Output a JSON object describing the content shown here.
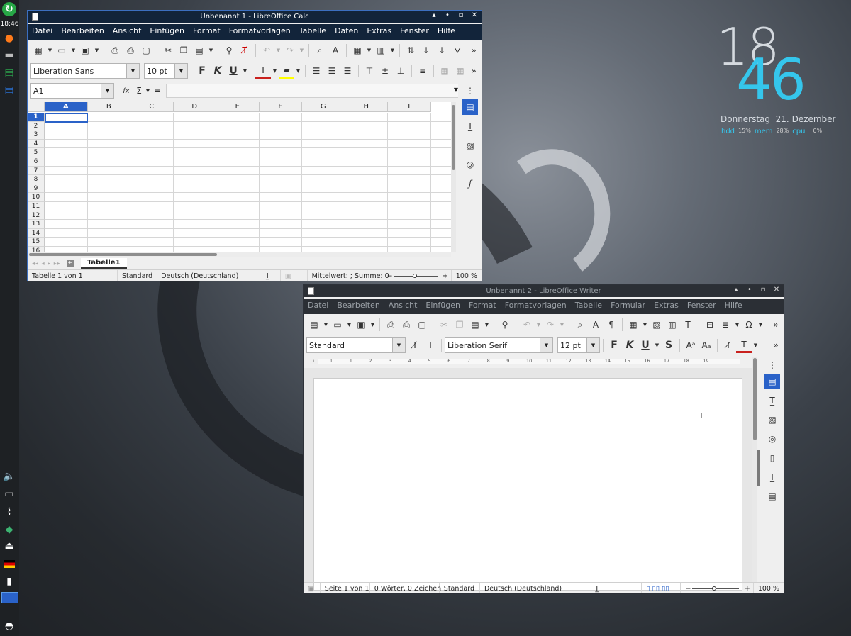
{
  "panel": {
    "time": "18:46"
  },
  "clock_widget": {
    "hour": "18",
    "minute": "46",
    "date": "Donnerstag  21. Dezember",
    "stats": [
      {
        "label": "hdd",
        "value": "15%"
      },
      {
        "label": "mem",
        "value": "28%"
      },
      {
        "label": "cpu",
        "value": "0%"
      }
    ]
  },
  "calc": {
    "title": "Unbenannt 1 - LibreOffice Calc",
    "menus": [
      "Datei",
      "Bearbeiten",
      "Ansicht",
      "Einfügen",
      "Format",
      "Formatvorlagen",
      "Tabelle",
      "Daten",
      "Extras",
      "Fenster",
      "Hilfe"
    ],
    "font_name": "Liberation Sans",
    "font_size": "10 pt",
    "bold_label": "F",
    "italic_label": "K",
    "underline_label": "U",
    "name_box": "A1",
    "formula_fx": "fx",
    "formula_sigma": "Σ",
    "formula_eq": "=",
    "columns": [
      "A",
      "B",
      "C",
      "D",
      "E",
      "F",
      "G",
      "H",
      "I"
    ],
    "rows": [
      "1",
      "2",
      "3",
      "4",
      "5",
      "6",
      "7",
      "8",
      "9",
      "10",
      "11",
      "12",
      "13",
      "14",
      "15",
      "16"
    ],
    "sheet_tab": "Tabelle1",
    "status": {
      "sheet": "Tabelle 1 von 1",
      "style": "Standard",
      "lang": "Deutsch (Deutschland)",
      "sum": "Mittelwert: ; Summe: 0",
      "zoom": "100 %"
    }
  },
  "writer": {
    "title": "Unbenannt 2 - LibreOffice Writer",
    "menus": [
      "Datei",
      "Bearbeiten",
      "Ansicht",
      "Einfügen",
      "Format",
      "Formatvorlagen",
      "Tabelle",
      "Formular",
      "Extras",
      "Fenster",
      "Hilfe"
    ],
    "para_style": "Standard",
    "font_name": "Liberation Serif",
    "font_size": "12 pt",
    "bold_label": "F",
    "italic_label": "K",
    "underline_label": "U",
    "strike_label": "S",
    "ruler": [
      "1",
      "1",
      "2",
      "3",
      "4",
      "5",
      "6",
      "7",
      "8",
      "9",
      "10",
      "11",
      "12",
      "13",
      "14",
      "15",
      "16",
      "17",
      "18",
      "19"
    ],
    "status": {
      "page": "Seite 1 von 1",
      "words": "0 Wörter, 0 Zeichen",
      "style": "Standard",
      "lang": "Deutsch (Deutschland)",
      "zoom": "100 %"
    }
  }
}
